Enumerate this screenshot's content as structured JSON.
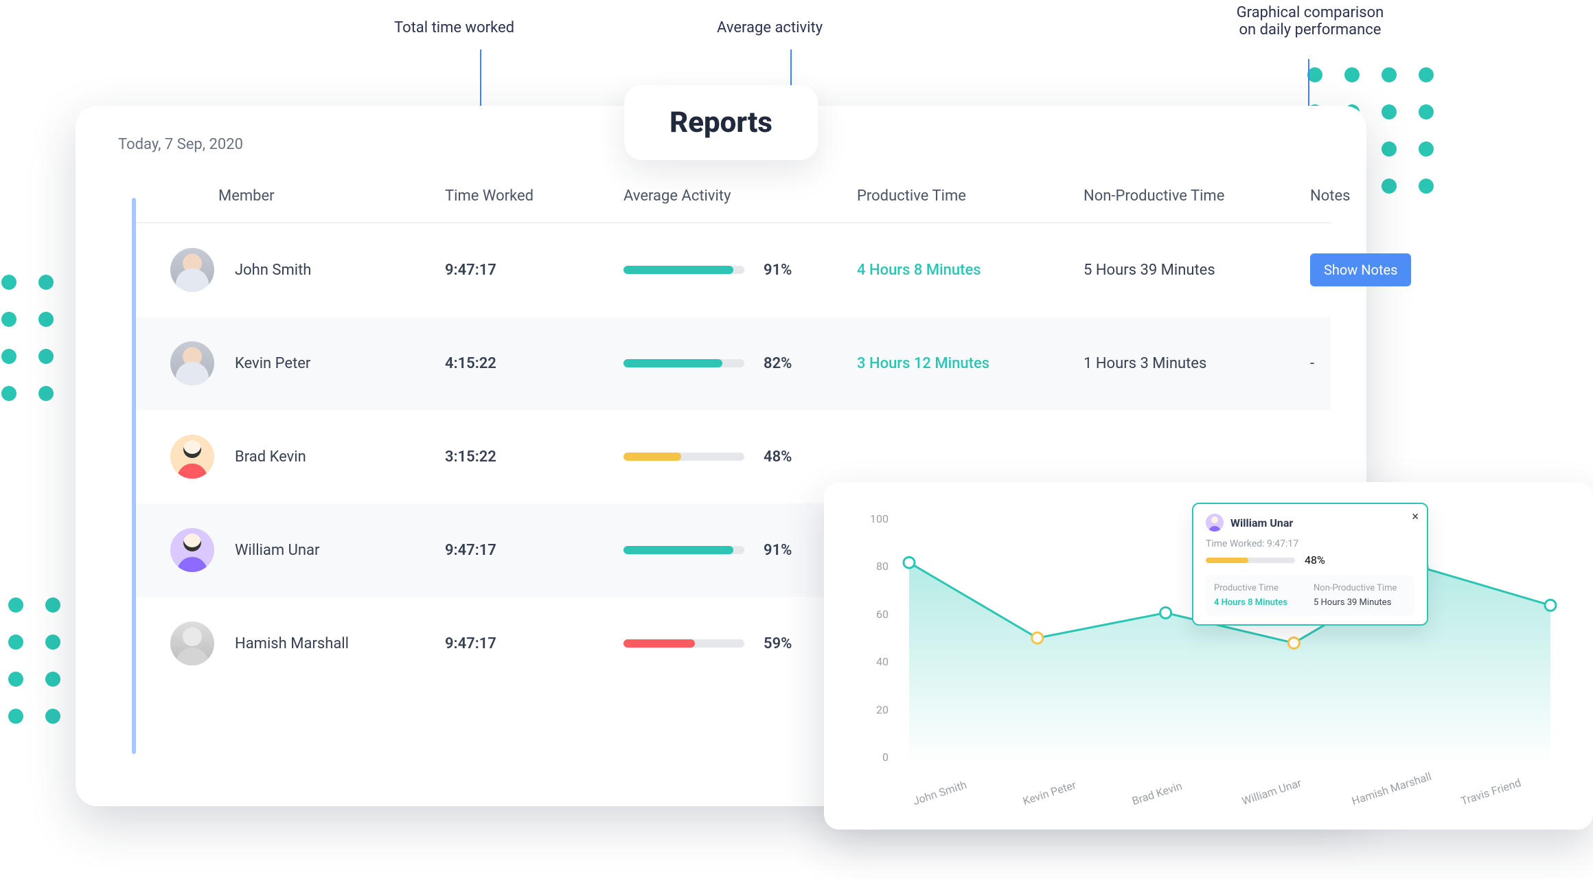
{
  "annotations": {
    "time_worked": "Total time worked",
    "avg_activity": "Average activity",
    "graph_compare_l1": "Graphical comparison",
    "graph_compare_l2": "on daily performance"
  },
  "report": {
    "title": "Reports",
    "date": "Today, 7 Sep, 2020",
    "columns": {
      "member": "Member",
      "time_worked": "Time Worked",
      "avg_activity": "Average Activity",
      "productive": "Productive Time",
      "non_productive": "Non-Productive Time",
      "notes": "Notes"
    },
    "show_notes_label": "Show Notes",
    "rows": [
      {
        "name": "John Smith",
        "time": "9:47:17",
        "pct": 91,
        "pct_label": "91%",
        "bar_color": "#2bc5b4",
        "prod": "4 Hours 8 Minutes",
        "nonp": "5 Hours 39 Minutes",
        "notes": "button",
        "avatar": "av-photo"
      },
      {
        "name": "Kevin Peter",
        "time": "4:15:22",
        "pct": 82,
        "pct_label": "82%",
        "bar_color": "#2bc5b4",
        "prod": "3 Hours 12 Minutes",
        "nonp": "1 Hours 3 Minutes",
        "notes": "-",
        "avatar": "av-photo"
      },
      {
        "name": "Brad Kevin",
        "time": "3:15:22",
        "pct": 48,
        "pct_label": "48%",
        "bar_color": "#f6c445",
        "prod": "",
        "nonp": "",
        "notes": "",
        "avatar": "av-flat"
      },
      {
        "name": "William Unar",
        "time": "9:47:17",
        "pct": 91,
        "pct_label": "91%",
        "bar_color": "#2bc5b4",
        "prod": "",
        "nonp": "",
        "notes": "",
        "avatar": "av-flat purple"
      },
      {
        "name": "Hamish Marshall",
        "time": "9:47:17",
        "pct": 59,
        "pct_label": "59%",
        "bar_color": "#ff5a5f",
        "prod": "",
        "nonp": "",
        "notes": "",
        "avatar": "av-photo2"
      }
    ]
  },
  "chart_data": {
    "type": "area",
    "x": [
      "John Smith",
      "Kevin Peter",
      "Brad Kevin",
      "William Unar",
      "Hamish Marshall",
      "Travis Friend"
    ],
    "values": [
      80,
      50,
      60,
      48,
      78,
      63
    ],
    "ylim": [
      0,
      100
    ],
    "yticks": [
      100,
      80,
      60,
      40,
      20,
      0
    ],
    "series_color": "#2bc5b4"
  },
  "tooltip": {
    "name": "William Unar",
    "time_worked_label": "Time Worked: 9:47:17",
    "pct": 48,
    "pct_label": "48%",
    "cols": {
      "prod_h": "Productive Time",
      "nonp_h": "Non-Productive Time",
      "prod_v": "4 Hours 8 Minutes",
      "nonp_v": "5 Hours 39 Minutes"
    }
  }
}
